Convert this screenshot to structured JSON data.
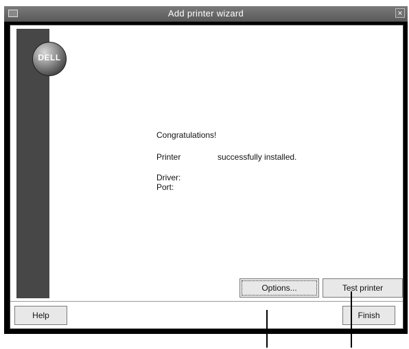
{
  "window": {
    "title": "Add printer wizard",
    "close_glyph": "×"
  },
  "banner": {
    "logo_text": "DELL"
  },
  "message": {
    "congrats": "Congratulations!",
    "printer_label": "Printer",
    "printer_status": "successfully installed.",
    "driver_label": "Driver:",
    "port_label": "Port:"
  },
  "buttons": {
    "options": "Options...",
    "test_printer": "Test printer",
    "help": "Help",
    "finish": "Finish"
  }
}
